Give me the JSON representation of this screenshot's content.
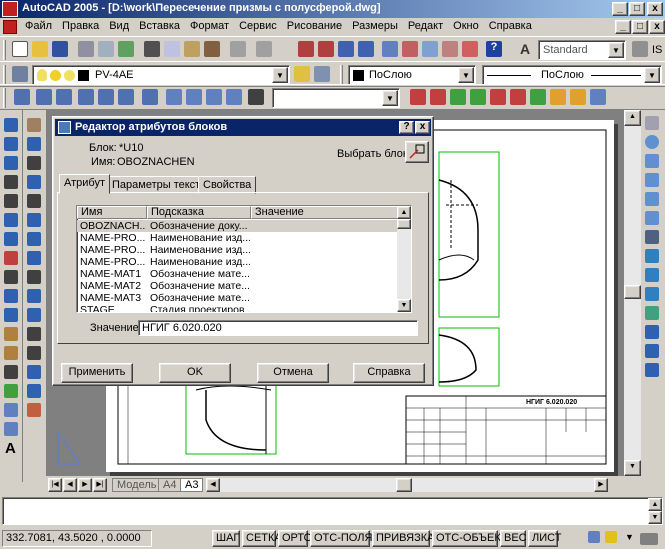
{
  "window": {
    "title": "AutoCAD 2005 - [D:\\work\\Пересечение призмы с полусферой.dwg]",
    "minimize": "_",
    "maximize": "□",
    "close": "x"
  },
  "menu": {
    "items": [
      "Файл",
      "Правка",
      "Вид",
      "Вставка",
      "Формат",
      "Сервис",
      "Рисование",
      "Размеры",
      "Редакт",
      "Окно",
      "Справка"
    ]
  },
  "toolbar1": {
    "text_style": "Standard",
    "text_style_suffix": "IS"
  },
  "toolbar2": {
    "layer": "PV-4AE",
    "color": "ПоСлою",
    "linetype": "ПоСлою"
  },
  "dialog": {
    "title": "Редактор атрибутов блоков",
    "help_btn": "?",
    "close_btn": "x",
    "block_label": "Блок:",
    "block_value": "*U10",
    "name_label": "Имя:",
    "name_value": "OBOZNACHEN",
    "select_block": "Выбрать блок",
    "tabs": [
      "Атрибут",
      "Параметры текста",
      "Свойства"
    ],
    "columns": [
      "Имя",
      "Подсказка",
      "Значение"
    ],
    "rows": [
      {
        "name": "OBOZNACH...",
        "prompt": "Обозначение доку...",
        "value": ""
      },
      {
        "name": "NAME-PRO...",
        "prompt": "Наименование изд...",
        "value": ""
      },
      {
        "name": "NAME-PRO...",
        "prompt": "Наименование изд...",
        "value": ""
      },
      {
        "name": "NAME-PRO...",
        "prompt": "Наименование изд...",
        "value": ""
      },
      {
        "name": "NAME-MAT1",
        "prompt": "Обозначение мате...",
        "value": ""
      },
      {
        "name": "NAME-MAT2",
        "prompt": "Обозначение мате...",
        "value": ""
      },
      {
        "name": "NAME-MAT3",
        "prompt": "Обозначение мате...",
        "value": ""
      },
      {
        "name": "STAGE",
        "prompt": "Стадия проектиров...",
        "value": ""
      }
    ],
    "value_label": "Значение:",
    "value_input": "НГИГ 6.020.020",
    "buttons": {
      "apply": "Применить",
      "ok": "OK",
      "cancel": "Отмена",
      "help": "Справка"
    }
  },
  "drawing": {
    "stamp_text": "НГИГ 6.020.020"
  },
  "layout_tabs": [
    "Модель",
    "A4",
    "A3"
  ],
  "status": {
    "coords": "332.7081, 43.5020 , 0.0000",
    "toggles": [
      "ШАГ",
      "СЕТКА",
      "ОРТО",
      "ОТС-ПОЛЯР",
      "ПРИВЯЗКА",
      "ОТС-ОБЪЕКТ",
      "ВЕС",
      "ЛИСТ"
    ]
  },
  "colors": {
    "title_active": "#0a246a",
    "face": "#d4d0c8",
    "model_bg": "#808080",
    "green_frame": "#00c000"
  }
}
